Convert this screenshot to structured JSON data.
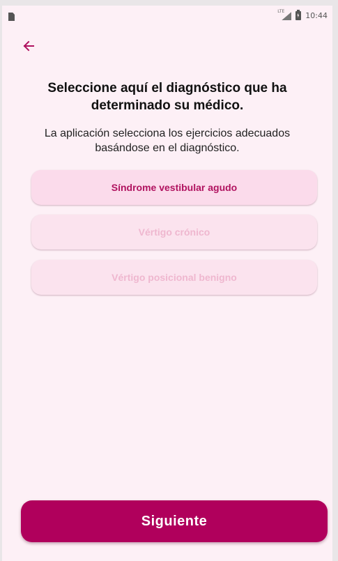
{
  "status_bar": {
    "time": "10:44",
    "network_label": "LTE",
    "left_icon": "sd-card-icon",
    "signal_icon": "signal-icon",
    "battery_icon": "battery-charging-icon"
  },
  "header": {
    "back_icon": "arrow-left-icon"
  },
  "main": {
    "title": "Seleccione aquí el diagnóstico que ha determinado su médico.",
    "subtitle": "La aplicación selecciona los ejercicios adecuados basándose en el diagnóstico.",
    "options": [
      {
        "label": "Síndrome vestibular agudo",
        "selected": true
      },
      {
        "label": "Vértigo crónico",
        "selected": false
      },
      {
        "label": "Vértigo posicional benigno",
        "selected": false
      }
    ]
  },
  "footer": {
    "next_label": "Siguiente"
  },
  "colors": {
    "accent": "#b0005c",
    "background": "#fdf0f6",
    "selected_option_bg": "#fbdbeb",
    "selected_option_text": "#b0125f",
    "unselected_option_bg": "#fbe3ee",
    "unselected_option_text": "#efb7cf"
  }
}
